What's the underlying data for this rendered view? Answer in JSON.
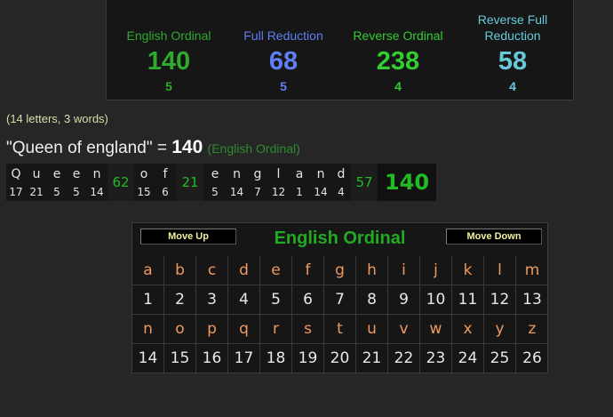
{
  "summary": {
    "ciphers": [
      {
        "name": "English Ordinal",
        "value": "140",
        "reduction": "5",
        "color": "#2eaa2e"
      },
      {
        "name": "Full Reduction",
        "value": "68",
        "reduction": "5",
        "color": "#5f7ff2"
      },
      {
        "name": "Reverse Ordinal",
        "value": "238",
        "reduction": "4",
        "color": "#33cc33"
      },
      {
        "name": "Reverse Full Reduction",
        "value": "58",
        "reduction": "4",
        "color": "#66c9d9"
      }
    ]
  },
  "note": "(14 letters, 3 words)",
  "phrase": {
    "text": "\"Queen of england\"",
    "equals": " = ",
    "sum": "140",
    "cipher": "(English Ordinal)"
  },
  "breakdown": {
    "words": [
      {
        "letters": [
          [
            "Q",
            "17"
          ],
          [
            "u",
            "21"
          ],
          [
            "e",
            "5"
          ],
          [
            "e",
            "5"
          ],
          [
            "n",
            "14"
          ]
        ],
        "sum": "62"
      },
      {
        "letters": [
          [
            "o",
            "15"
          ],
          [
            "f",
            "6"
          ]
        ],
        "sum": "21"
      },
      {
        "letters": [
          [
            "e",
            "5"
          ],
          [
            "n",
            "14"
          ],
          [
            "g",
            "7"
          ],
          [
            "l",
            "12"
          ],
          [
            "a",
            "1"
          ],
          [
            "n",
            "14"
          ],
          [
            "d",
            "4"
          ]
        ],
        "sum": "57"
      }
    ],
    "total": "140"
  },
  "chart": {
    "title": "English Ordinal",
    "move_up": "Move Up",
    "move_down": "Move Down",
    "rows": [
      {
        "letters": [
          "a",
          "b",
          "c",
          "d",
          "e",
          "f",
          "g",
          "h",
          "i",
          "j",
          "k",
          "l",
          "m"
        ],
        "values": [
          "1",
          "2",
          "3",
          "4",
          "5",
          "6",
          "7",
          "8",
          "9",
          "10",
          "11",
          "12",
          "13"
        ]
      },
      {
        "letters": [
          "n",
          "o",
          "p",
          "q",
          "r",
          "s",
          "t",
          "u",
          "v",
          "w",
          "x",
          "y",
          "z"
        ],
        "values": [
          "14",
          "15",
          "16",
          "17",
          "18",
          "19",
          "20",
          "21",
          "22",
          "23",
          "24",
          "25",
          "26"
        ]
      }
    ]
  }
}
